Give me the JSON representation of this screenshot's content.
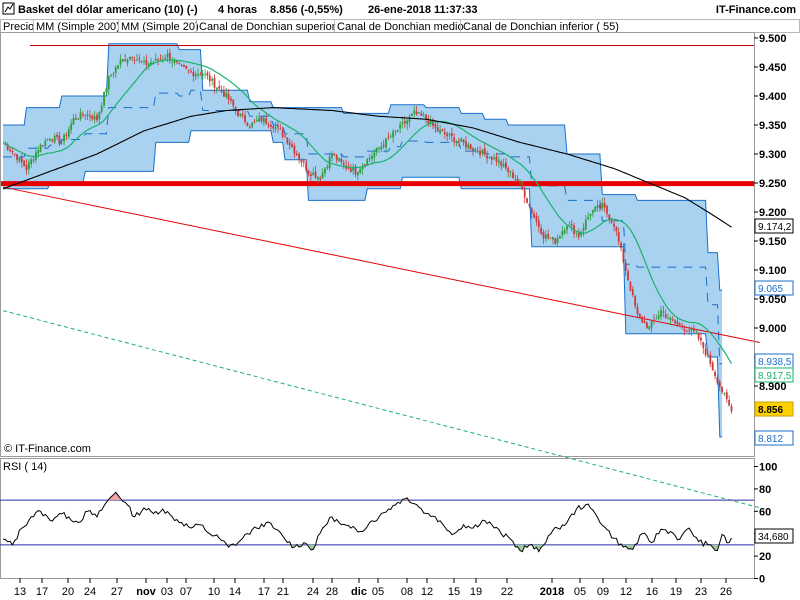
{
  "header": {
    "title": "Basket del dólar americano (10) (-)",
    "timeframe": "4 horas",
    "price_change": "8.856 (-0,55%)",
    "datetime": "26-ene-2018 11:37:33",
    "brand": "IT-Finance.com"
  },
  "legend": [
    {
      "label": "Precio",
      "color": "#000000"
    },
    {
      "label": "MM (Simple 200)",
      "color": "#000000"
    },
    {
      "label": "MM (Simple 20)",
      "color": "#19b36b"
    },
    {
      "label": "Canal de Donchian superior",
      "color": "#1a6fc9"
    },
    {
      "label": "Canal de Donchian medio",
      "color": "#1a6fc9"
    },
    {
      "label": "Canal de Donchian inferior ( 55)",
      "color": "#1a6fc9"
    }
  ],
  "watermark": "© IT-Finance.com",
  "rsi_label": "RSI ( 14)",
  "chart_data": {
    "type": "candlestick",
    "price_axis": {
      "min": 8.77,
      "max": 9.51,
      "ticks": [
        "9.500",
        "9.450",
        "9.400",
        "9.350",
        "9.300",
        "9.250",
        "9.200",
        "9.150",
        "9.100",
        "9.050",
        "9.000",
        "8.950",
        "8.900"
      ]
    },
    "x_tick_labels": [
      "13",
      "17",
      "20",
      "24",
      "27",
      "nov",
      "03",
      "07",
      "10",
      "14",
      "17",
      "21",
      "24",
      "28",
      "dic",
      "05",
      "08",
      "12",
      "15",
      "19",
      "22",
      "2018",
      "05",
      "09",
      "12",
      "16",
      "19",
      "23",
      "26"
    ],
    "value_boxes": [
      {
        "label": "9.174,2",
        "value": 9.1742,
        "color": "#000000",
        "bg": "#ffffff",
        "border": "#000000"
      },
      {
        "label": "9.065",
        "value": 9.065,
        "color": "#1a6fc9",
        "bg": "#ffffff",
        "border": "#1a6fc9"
      },
      {
        "label": "8.938,5",
        "value": 8.9385,
        "color": "#1a6fc9",
        "bg": "#ffffff",
        "border": "#1a6fc9"
      },
      {
        "label": "8.917,5",
        "value": 8.9175,
        "color": "#19b36b",
        "bg": "#ffffff",
        "border": "#19b36b"
      },
      {
        "label": "8.856",
        "value": 8.856,
        "color": "#000000",
        "bg": "#ffd000",
        "border": "#c9a400"
      },
      {
        "label": "8.812",
        "value": 8.812,
        "color": "#1a6fc9",
        "bg": "#ffffff",
        "border": "#1a6fc9"
      }
    ],
    "horizontal_lines": [
      {
        "value": 9.487,
        "color": "#cc0000",
        "width": 1
      },
      {
        "value": 9.249,
        "color": "#e60000",
        "width": 5
      }
    ],
    "close_anchors": [
      [
        0,
        9.32
      ],
      [
        5,
        9.3
      ],
      [
        10,
        9.275
      ],
      [
        15,
        9.31
      ],
      [
        20,
        9.33
      ],
      [
        25,
        9.32
      ],
      [
        30,
        9.36
      ],
      [
        35,
        9.37
      ],
      [
        40,
        9.36
      ],
      [
        45,
        9.43
      ],
      [
        50,
        9.46
      ],
      [
        55,
        9.47
      ],
      [
        60,
        9.455
      ],
      [
        65,
        9.46
      ],
      [
        70,
        9.47
      ],
      [
        75,
        9.45
      ],
      [
        80,
        9.44
      ],
      [
        85,
        9.44
      ],
      [
        90,
        9.42
      ],
      [
        95,
        9.4
      ],
      [
        100,
        9.37
      ],
      [
        105,
        9.35
      ],
      [
        110,
        9.36
      ],
      [
        115,
        9.35
      ],
      [
        120,
        9.33
      ],
      [
        125,
        9.3
      ],
      [
        130,
        9.27
      ],
      [
        135,
        9.26
      ],
      [
        140,
        9.3
      ],
      [
        145,
        9.28
      ],
      [
        150,
        9.27
      ],
      [
        155,
        9.29
      ],
      [
        160,
        9.31
      ],
      [
        165,
        9.33
      ],
      [
        170,
        9.35
      ],
      [
        175,
        9.37
      ],
      [
        180,
        9.36
      ],
      [
        185,
        9.34
      ],
      [
        190,
        9.33
      ],
      [
        195,
        9.32
      ],
      [
        200,
        9.31
      ],
      [
        205,
        9.3
      ],
      [
        210,
        9.29
      ],
      [
        215,
        9.27
      ],
      [
        220,
        9.25
      ],
      [
        225,
        9.2
      ],
      [
        230,
        9.16
      ],
      [
        235,
        9.15
      ],
      [
        240,
        9.18
      ],
      [
        245,
        9.16
      ],
      [
        250,
        9.2
      ],
      [
        255,
        9.21
      ],
      [
        260,
        9.18
      ],
      [
        265,
        9.1
      ],
      [
        270,
        9.02
      ],
      [
        275,
        9.0
      ],
      [
        280,
        9.03
      ],
      [
        285,
        9.01
      ],
      [
        290,
        9.0
      ],
      [
        295,
        8.99
      ],
      [
        300,
        8.95
      ],
      [
        305,
        8.9
      ],
      [
        310,
        8.856
      ]
    ],
    "sma200_anchors": [
      [
        0,
        9.24
      ],
      [
        20,
        9.27
      ],
      [
        40,
        9.3
      ],
      [
        60,
        9.34
      ],
      [
        80,
        9.365
      ],
      [
        95,
        9.375
      ],
      [
        115,
        9.38
      ],
      [
        140,
        9.375
      ],
      [
        160,
        9.365
      ],
      [
        180,
        9.36
      ],
      [
        200,
        9.345
      ],
      [
        220,
        9.32
      ],
      [
        240,
        9.3
      ],
      [
        260,
        9.275
      ],
      [
        275,
        9.25
      ],
      [
        290,
        9.225
      ],
      [
        300,
        9.2
      ],
      [
        310,
        9.174
      ]
    ],
    "donchian_upper_steps": [
      [
        0,
        9.35
      ],
      [
        10,
        9.38
      ],
      [
        25,
        9.4
      ],
      [
        45,
        9.49
      ],
      [
        75,
        9.48
      ],
      [
        85,
        9.41
      ],
      [
        105,
        9.39
      ],
      [
        115,
        9.38
      ],
      [
        145,
        9.37
      ],
      [
        165,
        9.385
      ],
      [
        180,
        9.38
      ],
      [
        195,
        9.37
      ],
      [
        205,
        9.36
      ],
      [
        215,
        9.35
      ],
      [
        240,
        9.3
      ],
      [
        255,
        9.23
      ],
      [
        270,
        9.22
      ],
      [
        285,
        9.22
      ],
      [
        300,
        9.13
      ],
      [
        305,
        9.065
      ]
    ],
    "donchian_lower_steps": [
      [
        0,
        9.24
      ],
      [
        20,
        9.25
      ],
      [
        35,
        9.27
      ],
      [
        55,
        9.27
      ],
      [
        65,
        9.32
      ],
      [
        80,
        9.34
      ],
      [
        95,
        9.34
      ],
      [
        115,
        9.32
      ],
      [
        120,
        9.29
      ],
      [
        130,
        9.22
      ],
      [
        155,
        9.24
      ],
      [
        170,
        9.26
      ],
      [
        195,
        9.24
      ],
      [
        225,
        9.14
      ],
      [
        265,
        8.99
      ],
      [
        300,
        8.95
      ],
      [
        305,
        8.812
      ]
    ],
    "trendlines": [
      {
        "from": [
          0,
          9.243
        ],
        "to": [
          322,
          8.975
        ],
        "color": "#e60000",
        "dash": false
      },
      {
        "from": [
          0,
          9.03
        ],
        "to": [
          322,
          8.69
        ],
        "color": "#19b36b",
        "dash": true
      }
    ],
    "rsi": {
      "axis_ticks": [
        100,
        80,
        60,
        40,
        20,
        0
      ],
      "levels": [
        70,
        30
      ],
      "last_value": "34,680",
      "anchors": [
        [
          0,
          35
        ],
        [
          4,
          30
        ],
        [
          8,
          45
        ],
        [
          12,
          55
        ],
        [
          16,
          60
        ],
        [
          20,
          52
        ],
        [
          24,
          58
        ],
        [
          28,
          55
        ],
        [
          32,
          50
        ],
        [
          36,
          60
        ],
        [
          40,
          55
        ],
        [
          44,
          68
        ],
        [
          48,
          77
        ],
        [
          52,
          68
        ],
        [
          56,
          55
        ],
        [
          60,
          63
        ],
        [
          64,
          58
        ],
        [
          68,
          62
        ],
        [
          72,
          55
        ],
        [
          76,
          50
        ],
        [
          80,
          45
        ],
        [
          84,
          48
        ],
        [
          88,
          40
        ],
        [
          92,
          36
        ],
        [
          96,
          28
        ],
        [
          100,
          32
        ],
        [
          104,
          40
        ],
        [
          108,
          45
        ],
        [
          112,
          50
        ],
        [
          116,
          44
        ],
        [
          120,
          35
        ],
        [
          124,
          28
        ],
        [
          128,
          32
        ],
        [
          132,
          26
        ],
        [
          136,
          45
        ],
        [
          140,
          55
        ],
        [
          144,
          48
        ],
        [
          148,
          45
        ],
        [
          152,
          42
        ],
        [
          156,
          50
        ],
        [
          160,
          55
        ],
        [
          164,
          62
        ],
        [
          168,
          68
        ],
        [
          172,
          72
        ],
        [
          176,
          66
        ],
        [
          180,
          58
        ],
        [
          184,
          55
        ],
        [
          188,
          46
        ],
        [
          192,
          40
        ],
        [
          196,
          48
        ],
        [
          200,
          45
        ],
        [
          204,
          52
        ],
        [
          208,
          48
        ],
        [
          212,
          40
        ],
        [
          216,
          35
        ],
        [
          220,
          25
        ],
        [
          224,
          30
        ],
        [
          228,
          24
        ],
        [
          232,
          38
        ],
        [
          236,
          45
        ],
        [
          240,
          50
        ],
        [
          244,
          62
        ],
        [
          248,
          66
        ],
        [
          252,
          58
        ],
        [
          256,
          46
        ],
        [
          260,
          36
        ],
        [
          264,
          28
        ],
        [
          268,
          26
        ],
        [
          272,
          40
        ],
        [
          276,
          32
        ],
        [
          280,
          44
        ],
        [
          284,
          42
        ],
        [
          288,
          35
        ],
        [
          292,
          45
        ],
        [
          296,
          33
        ],
        [
          300,
          30
        ],
        [
          304,
          25
        ],
        [
          306,
          40
        ],
        [
          308,
          32
        ],
        [
          310,
          34.68
        ]
      ]
    }
  },
  "colors": {
    "donchian_fill": "#a9d2f0",
    "donchian_line": "#1a6fc9",
    "sma20": "#19b36b",
    "sma200": "#000000",
    "candle_up": "#2e9e3e",
    "candle_down": "#cc3a3a",
    "rsi_over": "#f0a0a0",
    "rsi_under": "#9ccc9c",
    "rsi_level": "#2a2aa8"
  }
}
